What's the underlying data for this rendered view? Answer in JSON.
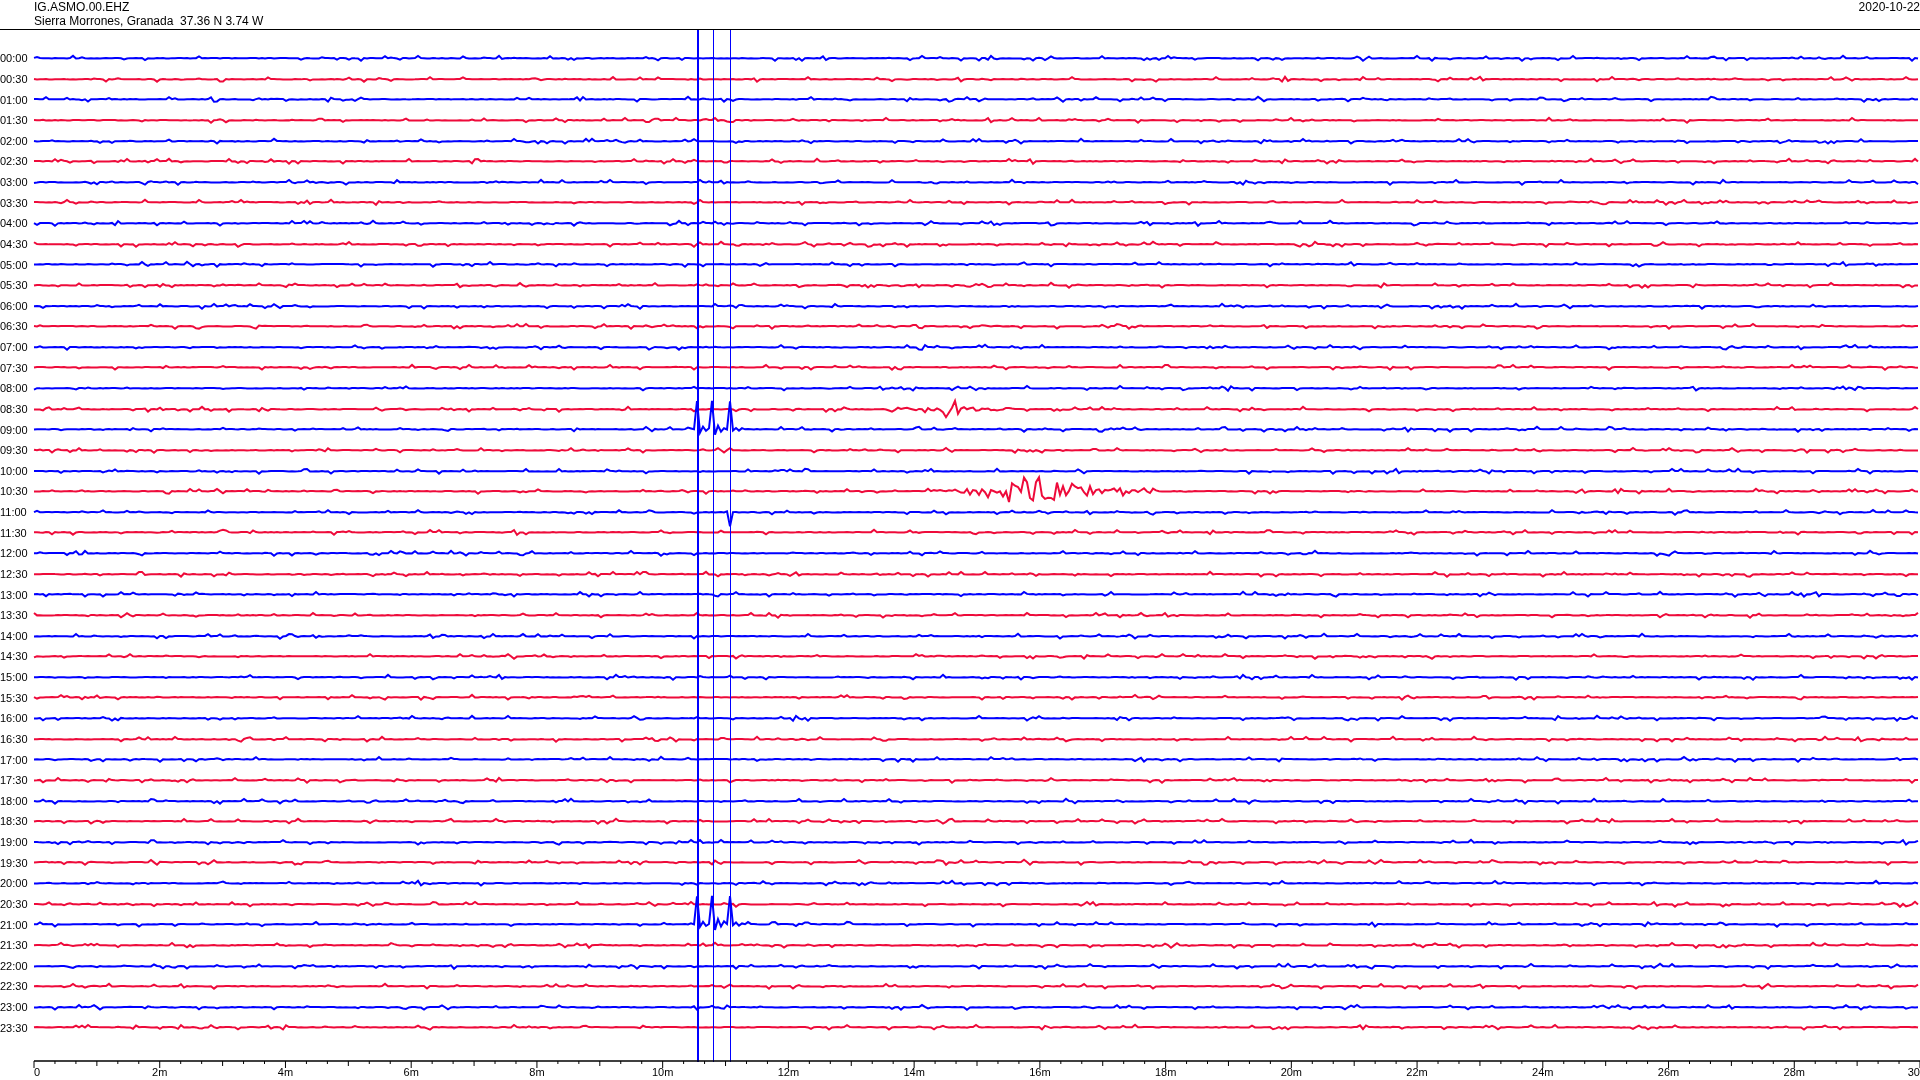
{
  "header": {
    "station": "IG.ASMO.00.EHZ",
    "location": "Sierra Morrones, Granada  37.36 N 3.74 W",
    "date": "2020-10-22"
  },
  "traces": [
    {
      "time": "00:00",
      "color": "#0000ff"
    },
    {
      "time": "00:30",
      "color": "#ee0a3a"
    },
    {
      "time": "01:00",
      "color": "#0000ff"
    },
    {
      "time": "01:30",
      "color": "#ee0a3a"
    },
    {
      "time": "02:00",
      "color": "#0000ff"
    },
    {
      "time": "02:30",
      "color": "#ee0a3a"
    },
    {
      "time": "03:00",
      "color": "#0000ff"
    },
    {
      "time": "03:30",
      "color": "#ee0a3a"
    },
    {
      "time": "04:00",
      "color": "#0000ff"
    },
    {
      "time": "04:30",
      "color": "#ee0a3a"
    },
    {
      "time": "05:00",
      "color": "#0000ff"
    },
    {
      "time": "05:30",
      "color": "#ee0a3a"
    },
    {
      "time": "06:00",
      "color": "#0000ff"
    },
    {
      "time": "06:30",
      "color": "#ee0a3a"
    },
    {
      "time": "07:00",
      "color": "#0000ff"
    },
    {
      "time": "07:30",
      "color": "#ee0a3a"
    },
    {
      "time": "08:00",
      "color": "#0000ff"
    },
    {
      "time": "08:30",
      "color": "#ee0a3a"
    },
    {
      "time": "09:00",
      "color": "#0000ff"
    },
    {
      "time": "09:30",
      "color": "#ee0a3a"
    },
    {
      "time": "10:00",
      "color": "#0000ff"
    },
    {
      "time": "10:30",
      "color": "#ee0a3a"
    },
    {
      "time": "11:00",
      "color": "#0000ff"
    },
    {
      "time": "11:30",
      "color": "#ee0a3a"
    },
    {
      "time": "12:00",
      "color": "#0000ff"
    },
    {
      "time": "12:30",
      "color": "#ee0a3a"
    },
    {
      "time": "13:00",
      "color": "#0000ff"
    },
    {
      "time": "13:30",
      "color": "#ee0a3a"
    },
    {
      "time": "14:00",
      "color": "#0000ff"
    },
    {
      "time": "14:30",
      "color": "#ee0a3a"
    },
    {
      "time": "15:00",
      "color": "#0000ff"
    },
    {
      "time": "15:30",
      "color": "#ee0a3a"
    },
    {
      "time": "16:00",
      "color": "#0000ff"
    },
    {
      "time": "16:30",
      "color": "#ee0a3a"
    },
    {
      "time": "17:00",
      "color": "#0000ff"
    },
    {
      "time": "17:30",
      "color": "#ee0a3a"
    },
    {
      "time": "18:00",
      "color": "#0000ff"
    },
    {
      "time": "18:30",
      "color": "#ee0a3a"
    },
    {
      "time": "19:00",
      "color": "#0000ff"
    },
    {
      "time": "19:30",
      "color": "#ee0a3a"
    },
    {
      "time": "20:00",
      "color": "#0000ff"
    },
    {
      "time": "20:30",
      "color": "#ee0a3a"
    },
    {
      "time": "21:00",
      "color": "#0000ff"
    },
    {
      "time": "21:30",
      "color": "#ee0a3a"
    },
    {
      "time": "22:00",
      "color": "#0000ff"
    },
    {
      "time": "22:30",
      "color": "#ee0a3a"
    },
    {
      "time": "23:00",
      "color": "#0000ff"
    },
    {
      "time": "23:30",
      "color": "#ee0a3a"
    }
  ],
  "x_axis": {
    "ticks": [
      "0",
      "2m",
      "4m",
      "6m",
      "8m",
      "10m",
      "12m",
      "14m",
      "16m",
      "18m",
      "20m",
      "22m",
      "24m",
      "26m",
      "28m",
      "30"
    ]
  }
}
